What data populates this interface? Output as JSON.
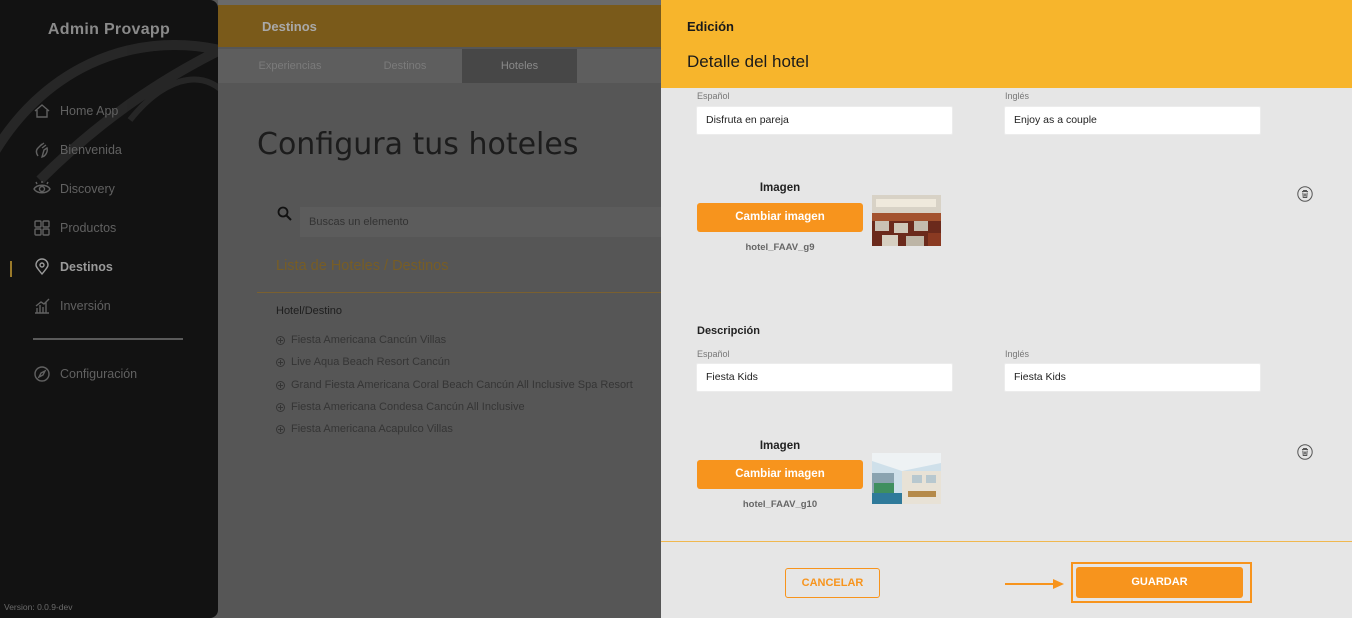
{
  "sidebar": {
    "brand": "Admin Provapp",
    "items": [
      {
        "label": "Home App",
        "icon": "home-icon"
      },
      {
        "label": "Bienvenida",
        "icon": "wave-hand-icon"
      },
      {
        "label": "Discovery",
        "icon": "eye-icon"
      },
      {
        "label": "Productos",
        "icon": "grid-icon"
      },
      {
        "label": "Destinos",
        "icon": "map-pin-icon",
        "active": true
      },
      {
        "label": "Inversión",
        "icon": "bar-chart-icon"
      }
    ],
    "config": {
      "label": "Configuración",
      "icon": "compass-icon"
    },
    "version": "Version: 0.0.9-dev"
  },
  "topbar": {
    "title": "Destinos"
  },
  "tabs": [
    {
      "label": "Experiencias"
    },
    {
      "label": "Destinos"
    },
    {
      "label": "Hoteles",
      "active": true
    }
  ],
  "main": {
    "title": "Configura tus hoteles",
    "search_placeholder": "Buscas un elemento",
    "list_title": "Lista de Hoteles / Destinos",
    "column_header": "Hotel/Destino",
    "hotels": [
      "Fiesta Americana Cancún Villas",
      "Live Aqua Beach Resort Cancún",
      "Grand Fiesta Americana Coral Beach Cancún All Inclusive Spa Resort",
      "Fiesta Americana Condesa Cancún All Inclusive",
      "Fiesta Americana Acapulco Villas"
    ]
  },
  "panel": {
    "header_small": "Edición",
    "header_title": "Detalle del hotel",
    "block1": {
      "es_label": "Español",
      "en_label": "Inglés",
      "es_value": "Disfruta en pareja",
      "en_value": "Enjoy as a couple",
      "image_label": "Imagen",
      "change_button": "Cambiar imagen",
      "filename": "hotel_FAAV_g9"
    },
    "block2": {
      "section_label": "Descripción",
      "es_label": "Español",
      "en_label": "Inglés",
      "es_value": "Fiesta Kids",
      "en_value": "Fiesta Kids",
      "image_label": "Imagen",
      "change_button": "Cambiar imagen",
      "filename": "hotel_FAAV_g10"
    },
    "cancel_button": "CANCELAR",
    "save_button": "GUARDAR"
  },
  "colors": {
    "accent": "#f7941d",
    "header": "#f7b52c",
    "sidebar": "#121212"
  }
}
